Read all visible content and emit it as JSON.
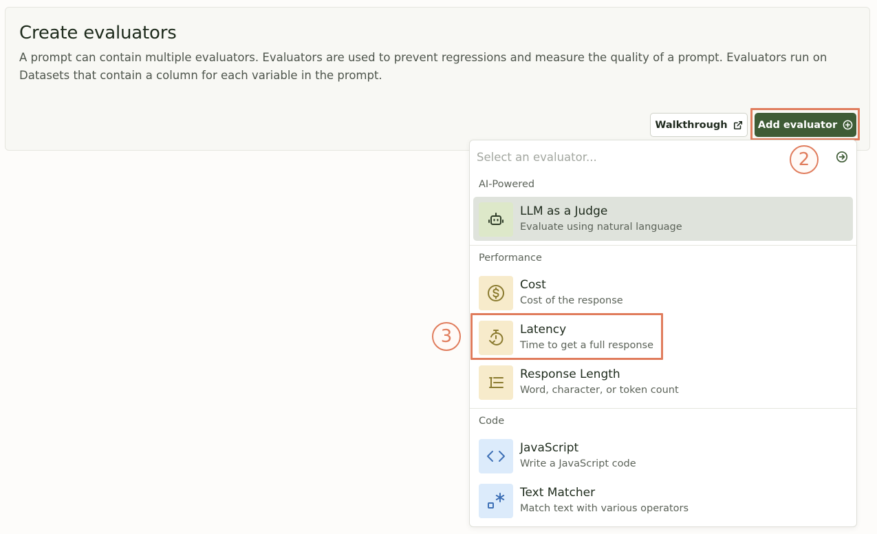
{
  "header": {
    "title": "Create evaluators",
    "description": "A prompt can contain multiple evaluators. Evaluators are used to prevent regressions and measure the quality of a prompt. Evaluators run on Datasets that contain a column for each variable in the prompt.",
    "walkthrough_label": "Walkthrough",
    "add_evaluator_label": "Add evaluator"
  },
  "dropdown": {
    "search_placeholder": "Select an evaluator...",
    "sections": [
      {
        "label": "AI-Powered",
        "items": [
          {
            "title": "LLM as a Judge",
            "subtitle": "Evaluate using natural language",
            "icon": "robot-icon"
          }
        ]
      },
      {
        "label": "Performance",
        "items": [
          {
            "title": "Cost",
            "subtitle": "Cost of the response",
            "icon": "dollar-icon"
          },
          {
            "title": "Latency",
            "subtitle": "Time to get a full response",
            "icon": "timer-icon"
          },
          {
            "title": "Response Length",
            "subtitle": "Word, character, or token count",
            "icon": "text-length-icon"
          }
        ]
      },
      {
        "label": "Code",
        "items": [
          {
            "title": "JavaScript",
            "subtitle": "Write a JavaScript code",
            "icon": "code-icon"
          },
          {
            "title": "Text Matcher",
            "subtitle": "Match text with various operators",
            "icon": "text-matcher-icon"
          }
        ]
      }
    ]
  },
  "annotations": {
    "step_2": "2",
    "step_3": "3"
  },
  "colors": {
    "primary": "#3f5c36",
    "highlight": "#e07c5c",
    "active_row": "#dfe3dc"
  }
}
